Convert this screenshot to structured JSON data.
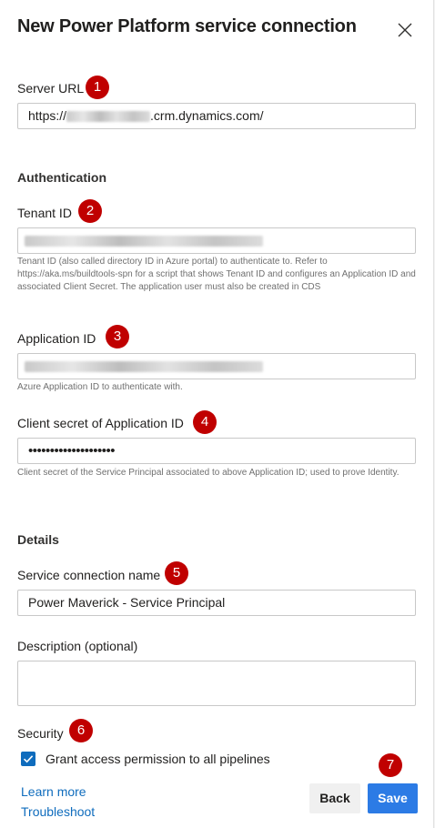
{
  "dialog": {
    "title": "New Power Platform service connection"
  },
  "server_url": {
    "label": "Server URL",
    "value_prefix": "https://",
    "value_suffix": ".crm.dynamics.com/"
  },
  "authentication": {
    "heading": "Authentication",
    "tenant_id": {
      "label": "Tenant ID",
      "help": "Tenant ID (also called directory ID in Azure portal) to authenticate to. Refer to https://aka.ms/buildtools-spn for a script that shows Tenant ID and configures an Application ID and associated Client Secret. The application user must also be created in CDS"
    },
    "application_id": {
      "label": "Application ID",
      "help": "Azure Application ID to authenticate with."
    },
    "client_secret": {
      "label": "Client secret of Application ID",
      "value": "••••••••••••••••••••",
      "help": "Client secret of the Service Principal associated to above Application ID; used to prove Identity."
    }
  },
  "details": {
    "heading": "Details",
    "connection_name": {
      "label": "Service connection name",
      "value": "Power Maverick - Service Principal"
    },
    "description": {
      "label": "Description (optional)",
      "value": ""
    }
  },
  "security": {
    "heading": "Security",
    "grant_access": {
      "label": "Grant access permission to all pipelines",
      "checked": true
    }
  },
  "footer": {
    "learn_more": "Learn more",
    "troubleshoot": "Troubleshoot",
    "back": "Back",
    "save": "Save"
  },
  "annotations": [
    "1",
    "2",
    "3",
    "4",
    "5",
    "6",
    "7"
  ],
  "colors": {
    "accent": "#0f6cbd",
    "save_button": "#2c7be5",
    "badge": "#c00000"
  },
  "icons": {
    "close": "close-icon",
    "check": "checkmark-icon"
  }
}
